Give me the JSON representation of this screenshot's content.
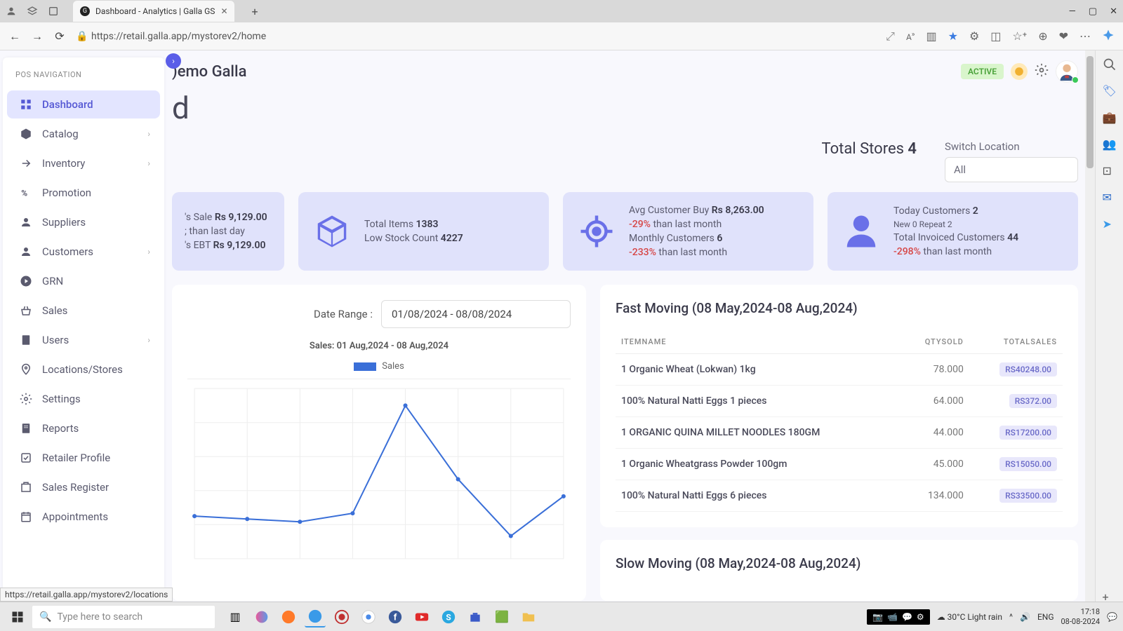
{
  "browser": {
    "tab_title": "Dashboard - Analytics | Galla GS",
    "url": "https://retail.galla.app/mystorev2/home",
    "hover_url": "https://retail.galla.app/mystorev2/locations"
  },
  "sidebar": {
    "heading": "POS NAVIGATION",
    "items": [
      {
        "label": "Dashboard",
        "icon": "grid",
        "active": true
      },
      {
        "label": "Catalog",
        "icon": "cube",
        "chev": true
      },
      {
        "label": "Inventory",
        "icon": "arrow",
        "chev": true
      },
      {
        "label": "Promotion",
        "icon": "percent"
      },
      {
        "label": "Suppliers",
        "icon": "user"
      },
      {
        "label": "Customers",
        "icon": "user",
        "chev": true
      },
      {
        "label": "GRN",
        "icon": "circle-play"
      },
      {
        "label": "Sales",
        "icon": "basket"
      },
      {
        "label": "Users",
        "icon": "book",
        "chev": true
      },
      {
        "label": "Locations/Stores",
        "icon": "pin",
        "highlight": true
      },
      {
        "label": "Settings",
        "icon": "gear"
      },
      {
        "label": "Reports",
        "icon": "doc"
      },
      {
        "label": "Retailer Profile",
        "icon": "check"
      },
      {
        "label": "Sales Register",
        "icon": "register"
      },
      {
        "label": "Appointments",
        "icon": "calendar"
      }
    ]
  },
  "header": {
    "title": ")emo Galla",
    "clipped_letter": "d",
    "active_badge": "ACTIVE"
  },
  "summary": {
    "total_stores_label": "Total Stores ",
    "total_stores_value": "4",
    "switch_location_label": "Switch Location",
    "switch_location_value": "All"
  },
  "stats": {
    "card1": {
      "line1_prefix": "'s Sale ",
      "line1_bold": "Rs 9,129.00",
      "line2": "; than last day",
      "line3_prefix": "'s EBT ",
      "line3_bold": "Rs 9,129.00"
    },
    "card2": {
      "l1_prefix": "Total Items ",
      "l1_bold": "1383",
      "l2_prefix": "Low Stock Count ",
      "l2_bold": "4227"
    },
    "card3": {
      "l1_prefix": "Avg Customer Buy ",
      "l1_bold": "Rs 8,263.00",
      "l2_neg": "-29%",
      "l2_rest": " than last month",
      "l3_prefix": "Monthly Customers ",
      "l3_bold": "6",
      "l4_neg": "-233%",
      "l4_rest": " than last month"
    },
    "card4": {
      "l1_prefix": "Today Customers ",
      "l1_bold": "2",
      "l2": "New  0   Repeat  2",
      "l3_prefix": "Total Invoiced Customers ",
      "l3_bold": "44",
      "l4_neg": "-298%",
      "l4_rest": " than last month"
    }
  },
  "chart": {
    "date_range_label": "Date Range :",
    "date_range_value": "01/08/2024 - 08/08/2024",
    "title": "Sales: 01 Aug,2024 - 08 Aug,2024",
    "legend": "Sales"
  },
  "chart_data": {
    "type": "line",
    "x": [
      1,
      2,
      3,
      4,
      5,
      6,
      7,
      8
    ],
    "values": [
      750,
      700,
      650,
      800,
      2700,
      1400,
      400,
      1100
    ],
    "series_name": "Sales",
    "title": "Sales: 01 Aug,2024 - 08 Aug,2024",
    "ylim": [
      0,
      3000
    ]
  },
  "fast_moving": {
    "title": "Fast Moving (08 May,2024-08 Aug,2024)",
    "cols": [
      "ITEMNAME",
      "QTYSOLD",
      "TOTALSALES"
    ],
    "rows": [
      {
        "name": "1 Organic Wheat (Lokwan) 1kg",
        "qty": "78.000",
        "total": "RS40248.00"
      },
      {
        "name": "100% Natural Natti Eggs 1 pieces",
        "qty": "64.000",
        "total": "RS372.00"
      },
      {
        "name": "1 ORGANIC QUINA MILLET NOODLES 180GM",
        "qty": "44.000",
        "total": "RS17200.00"
      },
      {
        "name": "1 Organic Wheatgrass Powder 100gm",
        "qty": "45.000",
        "total": "RS15050.00"
      },
      {
        "name": "100% Natural Natti Eggs 6 pieces",
        "qty": "134.000",
        "total": "RS33500.00"
      }
    ]
  },
  "slow_moving": {
    "title": "Slow Moving (08 May,2024-08 Aug,2024)"
  },
  "taskbar": {
    "search_placeholder": "Type here to search",
    "weather": "30°C  Light rain",
    "lang": "ENG",
    "time": "17:18",
    "date": "08-08-2024"
  }
}
